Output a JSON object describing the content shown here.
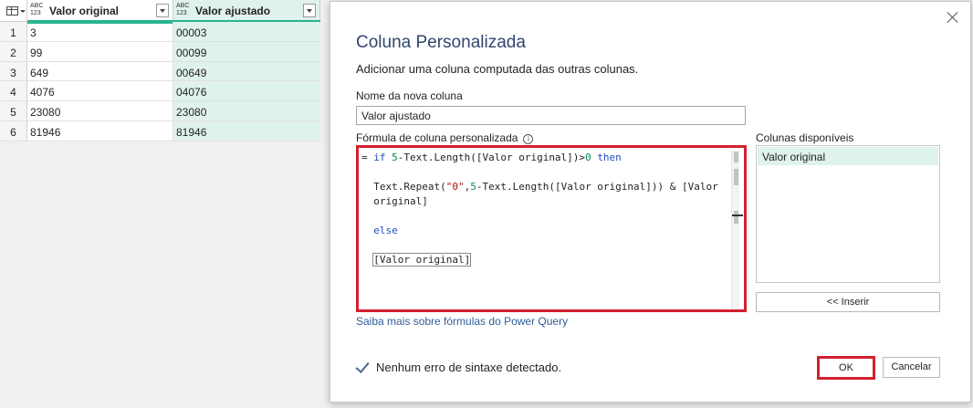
{
  "grid": {
    "columns": [
      {
        "type_top": "ABC",
        "type_bottom": "123",
        "name": "Valor original"
      },
      {
        "type_top": "ABC",
        "type_bottom": "123",
        "name": "Valor ajustado"
      }
    ],
    "rows": [
      {
        "idx": "1",
        "original": "3",
        "ajustado": "00003"
      },
      {
        "idx": "2",
        "original": "99",
        "ajustado": "00099"
      },
      {
        "idx": "3",
        "original": "649",
        "ajustado": "00649"
      },
      {
        "idx": "4",
        "original": "4076",
        "ajustado": "04076"
      },
      {
        "idx": "5",
        "original": "23080",
        "ajustado": "23080"
      },
      {
        "idx": "6",
        "original": "81946",
        "ajustado": "81946"
      }
    ],
    "colors": {
      "quality_bar": "#29b390",
      "highlight_column": "#dff2eb"
    }
  },
  "dialog": {
    "title": "Coluna Personalizada",
    "subtitle": "Adicionar uma coluna computada das outras colunas.",
    "new_column_label": "Nome da nova coluna",
    "new_column_value": "Valor ajustado",
    "formula_label": "Fórmula de coluna personalizada",
    "formula_info_icon": "info-icon",
    "formula": {
      "line1_prefix": "= ",
      "line1_if": "if",
      "line1_num": "5",
      "line1_rest": "-Text.Length([Valor original])>",
      "line1_zero": "0",
      "line1_then": "then",
      "line2_a": "Text.Repeat(",
      "line2_str": "\"0\"",
      "line2_b": ",",
      "line2_num": "5",
      "line2_c": "-Text.Length([Valor original])) & [Valor",
      "line3": "original]",
      "line4_else": "else",
      "line5": "[Valor original]"
    },
    "available_columns_label": "Colunas disponíveis",
    "available_columns": [
      "Valor original"
    ],
    "insert_label": "<< Inserir",
    "help_link": "Saiba mais sobre fórmulas do Power Query",
    "status_text": "Nenhum erro de sintaxe detectado.",
    "ok_label": "OK",
    "cancel_label": "Cancelar",
    "colors": {
      "highlight_border": "#d21f2f",
      "title": "#31466e"
    }
  }
}
